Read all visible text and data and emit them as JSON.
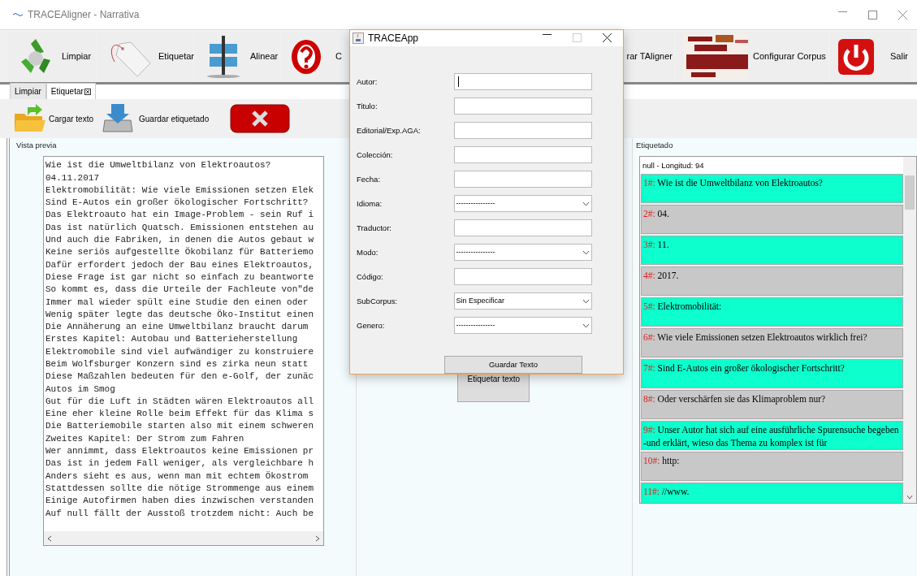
{
  "window": {
    "title": "TRACEAligner - Narrativa"
  },
  "toolbar": [
    {
      "label": "Limpiar",
      "kind": "recycle"
    },
    {
      "label": "Etiquetar",
      "kind": "tag"
    },
    {
      "label": "Alinear",
      "kind": "align"
    },
    {
      "label": "C",
      "kind": "help"
    },
    {
      "label": "rar TAligner",
      "kind": "none"
    },
    {
      "label": "Configurar Corpus",
      "kind": "cloud"
    },
    {
      "label": "Salir",
      "kind": "power"
    }
  ],
  "tabs": [
    {
      "label": "Limpiar",
      "selected": false,
      "closable": false
    },
    {
      "label": "Etiquetar",
      "selected": true,
      "closable": true
    }
  ],
  "actions": [
    {
      "label": "Cargar texto",
      "kind": "open"
    },
    {
      "label": "Guardar etiquetado",
      "kind": "save"
    },
    {
      "kind": "delete"
    }
  ],
  "preview": {
    "title": "Vista previa",
    "lines": [
      "Wie ist die Umweltbilanz von Elektroautos?",
      "04.11.2017",
      "Elektromobilität: Wie viele Emissionen setzen Elek",
      "Sind E-Autos ein großer ökologischer Fortschritt?",
      "Das Elektroauto hat ein Image-Problem - sein Ruf i",
      "Das ist natürlich Quatsch. Emissionen entstehen au",
      "Und auch die Fabriken, in denen die Autos gebaut w",
      "Keine seriös aufgestellte Ökobilanz für Batteriemo",
      "Dafür erfordert jedoch der Bau eines Elektroautos,",
      "Diese Frage ist gar nicht so einfach zu beantworte",
      "So kommt es, dass die Urteile der Fachleute von\"de",
      "Immer mal wieder spült eine Studie den einen oder",
      "Wenig später legte das deutsche Öko-Institut einen",
      "Die Annäherung an eine Umweltbilanz braucht darum",
      "Erstes Kapitel: Autobau und Batterieherstellung",
      "Elektromobile sind viel aufwändiger zu konstruiere",
      "Beim Wolfsburger Konzern sind es zirka neun statt",
      "Diese Maßzahlen bedeuten für den e-Golf, der zunäc",
      "Autos im Smog",
      "Gut für die Luft in Städten wären Elektroautos all",
      "Eine eher kleine Rolle beim Effekt für das Klima s",
      "Die Batteriemobile starten also mit einem schweren",
      "Zweites Kapitel: Der Strom zum Fahren",
      "Wer annimmt, dass Elektroautos keine Emissionen pr",
      "Das ist in jedem Fall weniger, als vergleichbare h",
      "Anders sieht es aus, wenn man mit echtem Ökostrom",
      "Stattdessen sollte die nötige Strommenge aus einem",
      "Einige Autofirmen haben dies inzwischen verstanden",
      "Auf null fällt der Ausstoß trotzdem nicht: Auch be"
    ]
  },
  "center": {
    "button": "Etiquetar texto"
  },
  "tagged": {
    "title": "Etiquetado",
    "header": "null - Longitud: 94",
    "segments": [
      {
        "number": "1#:",
        "text": "Wie ist die Umweltbilanz von Elektroautos?",
        "color": "#0cffcc"
      },
      {
        "number": "2#:",
        "text": "04.",
        "color": "#c8c8c8"
      },
      {
        "number": "3#:",
        "text": "11.",
        "color": "#0cffcc"
      },
      {
        "number": "4#:",
        "text": "2017.",
        "color": "#c8c8c8"
      },
      {
        "number": "5#:",
        "text": "Elektromobilität:",
        "color": "#0cffcc"
      },
      {
        "number": "6#:",
        "text": "Wie viele Emissionen setzen Elektroautos wirklich frei?",
        "color": "#c8c8c8"
      },
      {
        "number": "7#:",
        "text": "Sind E-Autos ein großer ökologischer Fortschritt?",
        "color": "#0cffcc"
      },
      {
        "number": "8#:",
        "text": "Oder verschärfen sie das Klimaproblem nur?",
        "color": "#c8c8c8"
      },
      {
        "number": "9#:",
        "text": "Unser Autor hat sich auf eine ausführliche Spurensuche begeben -und erklärt, wieso das Thema zu komplex ist für",
        "color": "#0cffcc"
      },
      {
        "number": "10#:",
        "text": "http:",
        "color": "#c8c8c8"
      },
      {
        "number": "11#:",
        "text": "//www.",
        "color": "#0cffcc"
      }
    ]
  },
  "dialog": {
    "title": "TRACEApp",
    "fields": [
      {
        "label": "Autor:",
        "kind": "text",
        "focused": true
      },
      {
        "label": "Titulo:",
        "kind": "text",
        "focused": false
      },
      {
        "label": "Editorial/Exp.AGA:",
        "kind": "text",
        "focused": false
      },
      {
        "label": "Colección:",
        "kind": "text",
        "focused": false
      },
      {
        "label": "Fecha:",
        "kind": "text",
        "focused": false
      },
      {
        "label": "Idioma:",
        "kind": "select",
        "value": "----------------"
      },
      {
        "label": "Traductor:",
        "kind": "text",
        "focused": false
      },
      {
        "label": "Modo:",
        "kind": "select",
        "value": "----------------"
      },
      {
        "label": "Código:",
        "kind": "text",
        "focused": false
      },
      {
        "label": "SubCorpus:",
        "kind": "select",
        "value": "Sin Especificar"
      },
      {
        "label": "Genero:",
        "kind": "select",
        "value": "----------------"
      }
    ],
    "button": "Guardar Texto"
  }
}
